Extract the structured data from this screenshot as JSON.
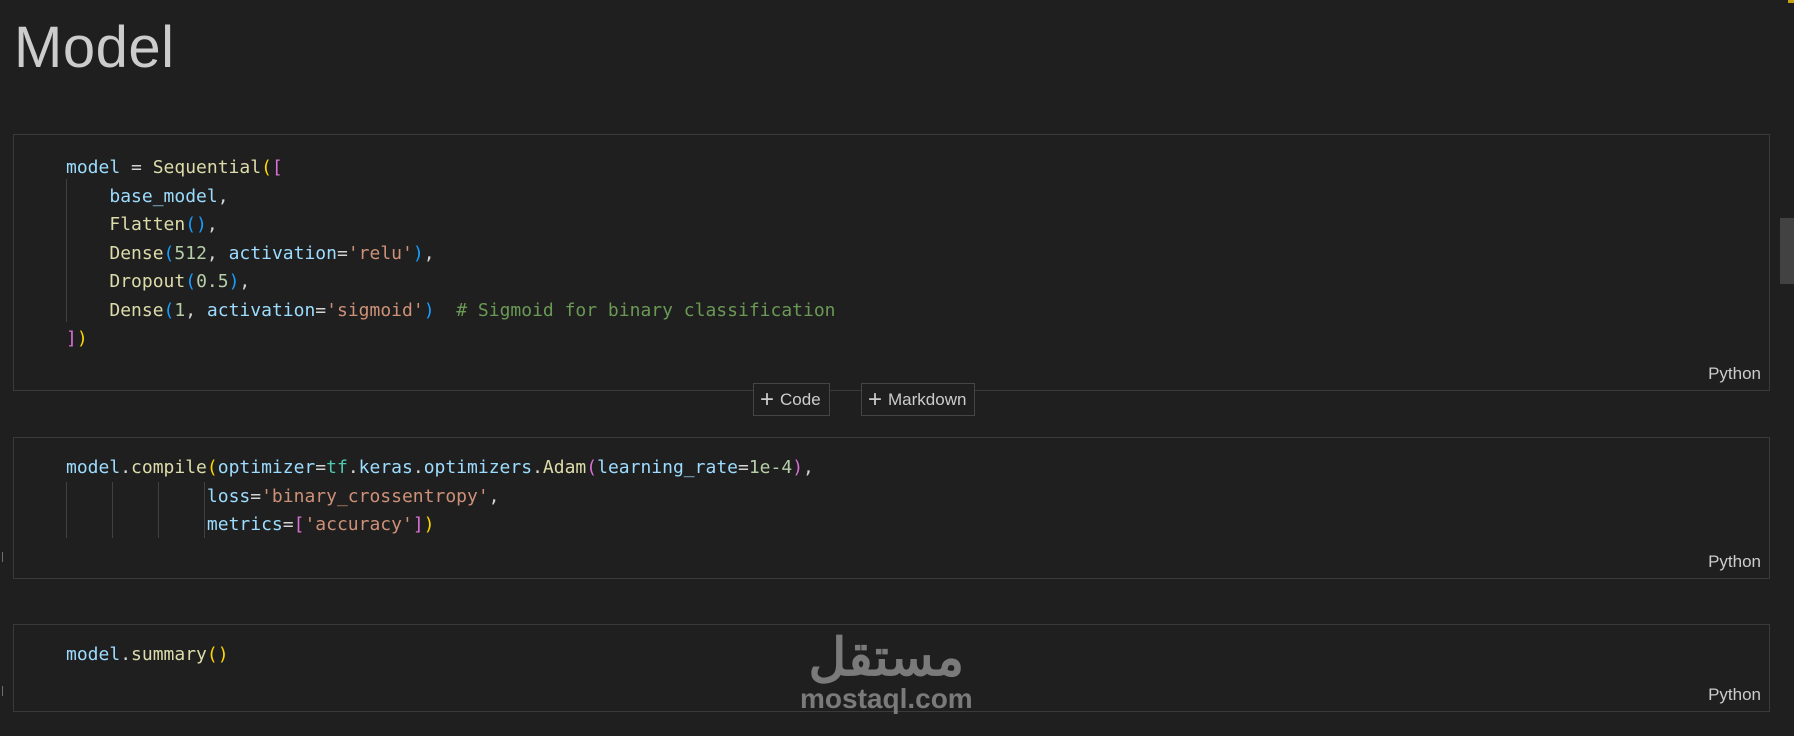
{
  "heading": "Model",
  "cells": [
    {
      "language": "Python",
      "lines": [
        [
          [
            "model",
            "kw"
          ],
          [
            " = ",
            "op"
          ],
          [
            "Sequential",
            "fn"
          ],
          [
            "(",
            "b1"
          ],
          [
            "[",
            "b2"
          ]
        ],
        [
          [
            "    ",
            "op"
          ],
          [
            "base_model",
            "kw"
          ],
          [
            ",",
            "op"
          ]
        ],
        [
          [
            "    ",
            "op"
          ],
          [
            "Flatten",
            "fn"
          ],
          [
            "()",
            "b3"
          ],
          [
            ",",
            "op"
          ]
        ],
        [
          [
            "    ",
            "op"
          ],
          [
            "Dense",
            "fn"
          ],
          [
            "(",
            "b3"
          ],
          [
            "512",
            "num"
          ],
          [
            ", ",
            "op"
          ],
          [
            "activation",
            "kw"
          ],
          [
            "=",
            "op"
          ],
          [
            "'relu'",
            "str"
          ],
          [
            ")",
            "b3"
          ],
          [
            ",",
            "op"
          ]
        ],
        [
          [
            "    ",
            "op"
          ],
          [
            "Dropout",
            "fn"
          ],
          [
            "(",
            "b3"
          ],
          [
            "0.5",
            "num"
          ],
          [
            ")",
            "b3"
          ],
          [
            ",",
            "op"
          ]
        ],
        [
          [
            "    ",
            "op"
          ],
          [
            "Dense",
            "fn"
          ],
          [
            "(",
            "b3"
          ],
          [
            "1",
            "num"
          ],
          [
            ", ",
            "op"
          ],
          [
            "activation",
            "kw"
          ],
          [
            "=",
            "op"
          ],
          [
            "'sigmoid'",
            "str"
          ],
          [
            ")",
            "b3"
          ],
          [
            "  ",
            "op"
          ],
          [
            "# Sigmoid for binary classification",
            "cm"
          ]
        ],
        [
          [
            "]",
            "b2"
          ],
          [
            ")",
            "b1"
          ]
        ]
      ]
    },
    {
      "language": "Python",
      "lines": [
        [
          [
            "model",
            "kw"
          ],
          [
            ".",
            "op"
          ],
          [
            "compile",
            "fn"
          ],
          [
            "(",
            "b1"
          ],
          [
            "optimizer",
            "kw"
          ],
          [
            "=",
            "op"
          ],
          [
            "tf",
            "cls"
          ],
          [
            ".",
            "op"
          ],
          [
            "keras",
            "kw"
          ],
          [
            ".",
            "op"
          ],
          [
            "optimizers",
            "kw"
          ],
          [
            ".",
            "op"
          ],
          [
            "Adam",
            "fn"
          ],
          [
            "(",
            "b2"
          ],
          [
            "learning_rate",
            "kw"
          ],
          [
            "=",
            "op"
          ],
          [
            "1e-4",
            "num"
          ],
          [
            ")",
            "b2"
          ],
          [
            ",",
            "op"
          ]
        ],
        [
          [
            "             ",
            "op"
          ],
          [
            "loss",
            "kw"
          ],
          [
            "=",
            "op"
          ],
          [
            "'binary_crossentropy'",
            "str"
          ],
          [
            ",",
            "op"
          ]
        ],
        [
          [
            "             ",
            "op"
          ],
          [
            "metrics",
            "kw"
          ],
          [
            "=",
            "op"
          ],
          [
            "[",
            "b2"
          ],
          [
            "'accuracy'",
            "str"
          ],
          [
            "]",
            "b2"
          ],
          [
            ")",
            "b1"
          ]
        ]
      ]
    },
    {
      "language": "Python",
      "lines": [
        [
          [
            "model",
            "kw"
          ],
          [
            ".",
            "op"
          ],
          [
            "summary",
            "fn"
          ],
          [
            "()",
            "b1"
          ]
        ]
      ]
    }
  ],
  "add_buttons": {
    "code_label": "Code",
    "markdown_label": "Markdown"
  },
  "watermark": {
    "arabic": "مستقل",
    "latin": "mostaql.com"
  }
}
